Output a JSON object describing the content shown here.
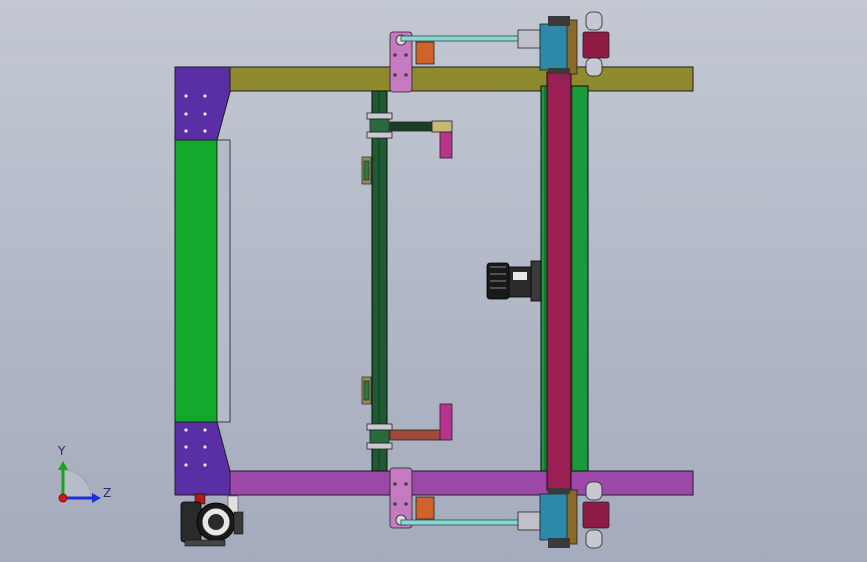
{
  "viewport": {
    "background_top": "#c3c8d2",
    "background_bottom": "#a4abbd"
  },
  "colors": {
    "frame_olive": "#8e8a2e",
    "frame_purple": "#9b48a8",
    "corner_plate": "#5a2ea4",
    "side_green": "#13a92c",
    "beam_dark_green": "#1f5a33",
    "rail_crimson": "#9a1f52",
    "rail_green": "#1a9a3a",
    "carriage_teal": "#2a8aa8",
    "block_orange": "#d0622a",
    "block_maroon": "#8e1c44",
    "bracket_pink": "#c67ac2",
    "motor_black": "#1a1a1a"
  },
  "triad": {
    "y_label": "Y",
    "z_label": "Z",
    "y_color": "#1aa31a",
    "z_color": "#1f2fd6",
    "x_color": "#d01818"
  }
}
